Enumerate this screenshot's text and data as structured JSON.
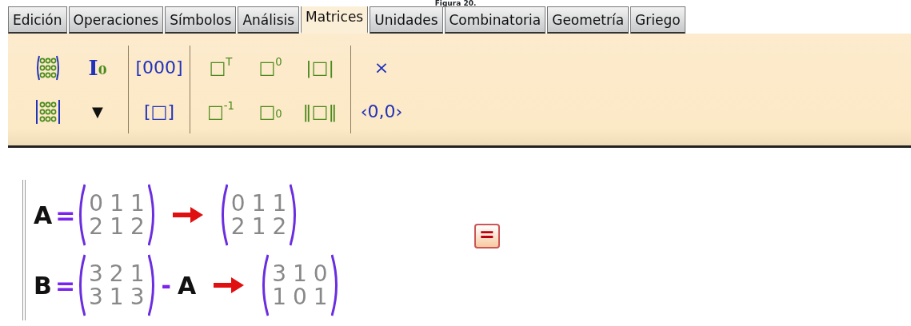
{
  "caption": "Figura 20.",
  "tabs": [
    {
      "label": "Edición",
      "selected": false
    },
    {
      "label": "Operaciones",
      "selected": false
    },
    {
      "label": "Símbolos",
      "selected": false
    },
    {
      "label": "Análisis",
      "selected": false
    },
    {
      "label": "Matrices",
      "selected": true
    },
    {
      "label": "Unidades",
      "selected": false
    },
    {
      "label": "Combinatoria",
      "selected": false
    },
    {
      "label": "Geometría",
      "selected": false
    },
    {
      "label": "Griego",
      "selected": false
    }
  ],
  "toolbar_groups": [
    [
      {
        "kind": "matrix-paren"
      },
      {
        "kind": "identity",
        "label": "I$_{0}$"
      },
      {
        "kind": "matrix-bars"
      },
      {
        "kind": "dropdown",
        "label": "▼"
      }
    ],
    [
      {
        "kind": "text",
        "label": "[000]"
      },
      {
        "kind": "text",
        "label": "[□]"
      }
    ],
    [
      {
        "kind": "text",
        "label": "□$^{T}$"
      },
      {
        "kind": "text",
        "label": "□$^{0}$"
      },
      {
        "kind": "text",
        "label": "|□|"
      },
      {
        "kind": "text",
        "label": "□$^{-1}$"
      },
      {
        "kind": "text",
        "label": "□$_{0}$"
      },
      {
        "kind": "text",
        "label": "‖□‖"
      }
    ],
    [
      {
        "kind": "text",
        "label": "×"
      },
      {
        "kind": "text",
        "label": "‹0,0›"
      }
    ]
  ],
  "expressions": [
    {
      "parts": [
        {
          "kind": "symbol",
          "text": "A"
        },
        {
          "kind": "equals",
          "text": "="
        },
        {
          "kind": "matrix",
          "rows": [
            [
              "0",
              "1",
              "1"
            ],
            [
              "2",
              "1",
              "2"
            ]
          ]
        },
        {
          "kind": "arrow"
        },
        {
          "kind": "matrix",
          "rows": [
            [
              "0",
              "1",
              "1"
            ],
            [
              "2",
              "1",
              "2"
            ]
          ]
        }
      ]
    },
    {
      "parts": [
        {
          "kind": "symbol",
          "text": "B"
        },
        {
          "kind": "equals",
          "text": "="
        },
        {
          "kind": "matrix",
          "rows": [
            [
              "3",
              "2",
              "1"
            ],
            [
              "3",
              "1",
              "3"
            ]
          ]
        },
        {
          "kind": "operator",
          "text": "-"
        },
        {
          "kind": "symbol",
          "text": "A"
        },
        {
          "kind": "arrow"
        },
        {
          "kind": "matrix",
          "rows": [
            [
              "3",
              "1",
              "0"
            ],
            [
              "1",
              "0",
              "1"
            ]
          ]
        }
      ]
    }
  ],
  "evaluate_button": {
    "label": "="
  }
}
